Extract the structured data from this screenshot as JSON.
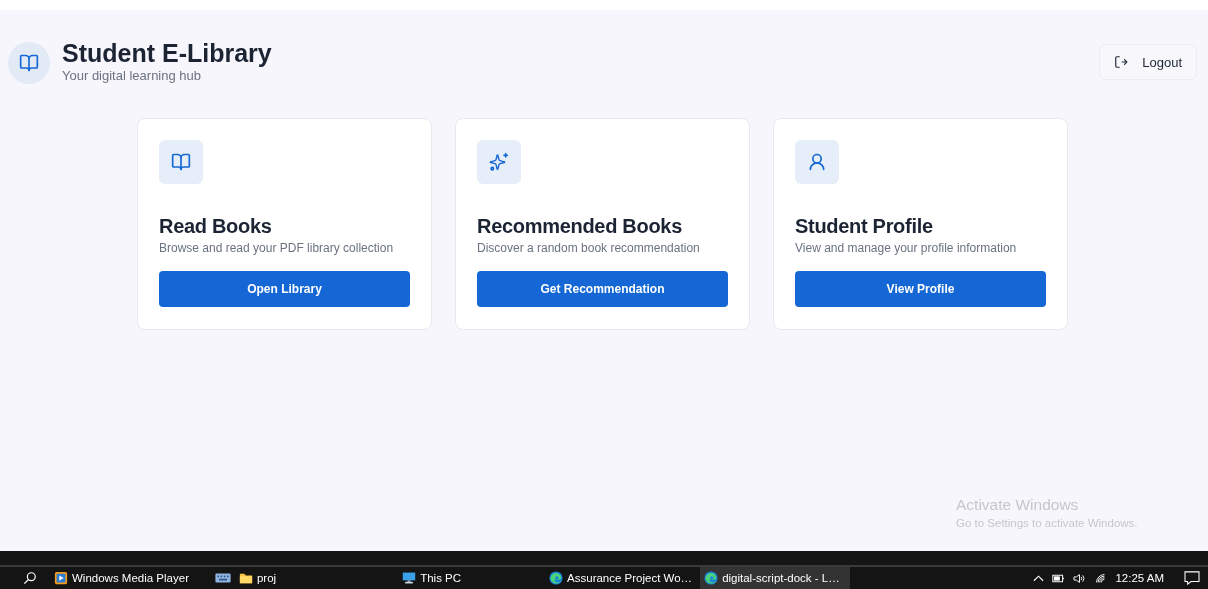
{
  "header": {
    "title": "Student E-Library",
    "subtitle": "Your digital learning hub",
    "logout": "Logout"
  },
  "cards": [
    {
      "kind": "book",
      "title": "Read Books",
      "description": "Browse and read your PDF library collection",
      "button": "Open Library"
    },
    {
      "kind": "sparkles",
      "title": "Recommended Books",
      "description": "Discover a random book recommendation",
      "button": "Get Recommendation"
    },
    {
      "kind": "user",
      "title": "Student Profile",
      "description": "View and manage your profile information",
      "button": "View Profile"
    }
  ],
  "activation_notice": {
    "title": "Activate Windows",
    "text": "Go to Settings to activate Windows."
  },
  "taskbar": {
    "apps": [
      {
        "kind": "media",
        "label": "Windows Media Player",
        "selected": false
      },
      {
        "kind": "keyboard",
        "selected": false
      },
      {
        "kind": "folder",
        "label": "proj",
        "selected": false
      },
      {
        "kind": "pc",
        "label": "This PC",
        "selected": false
      },
      {
        "kind": "edge",
        "label": "Assurance Project Wo…",
        "selected": false
      },
      {
        "kind": "edge",
        "label": "digital-script-dock - L…",
        "selected": true
      }
    ],
    "clock": "12:25 AM"
  }
}
